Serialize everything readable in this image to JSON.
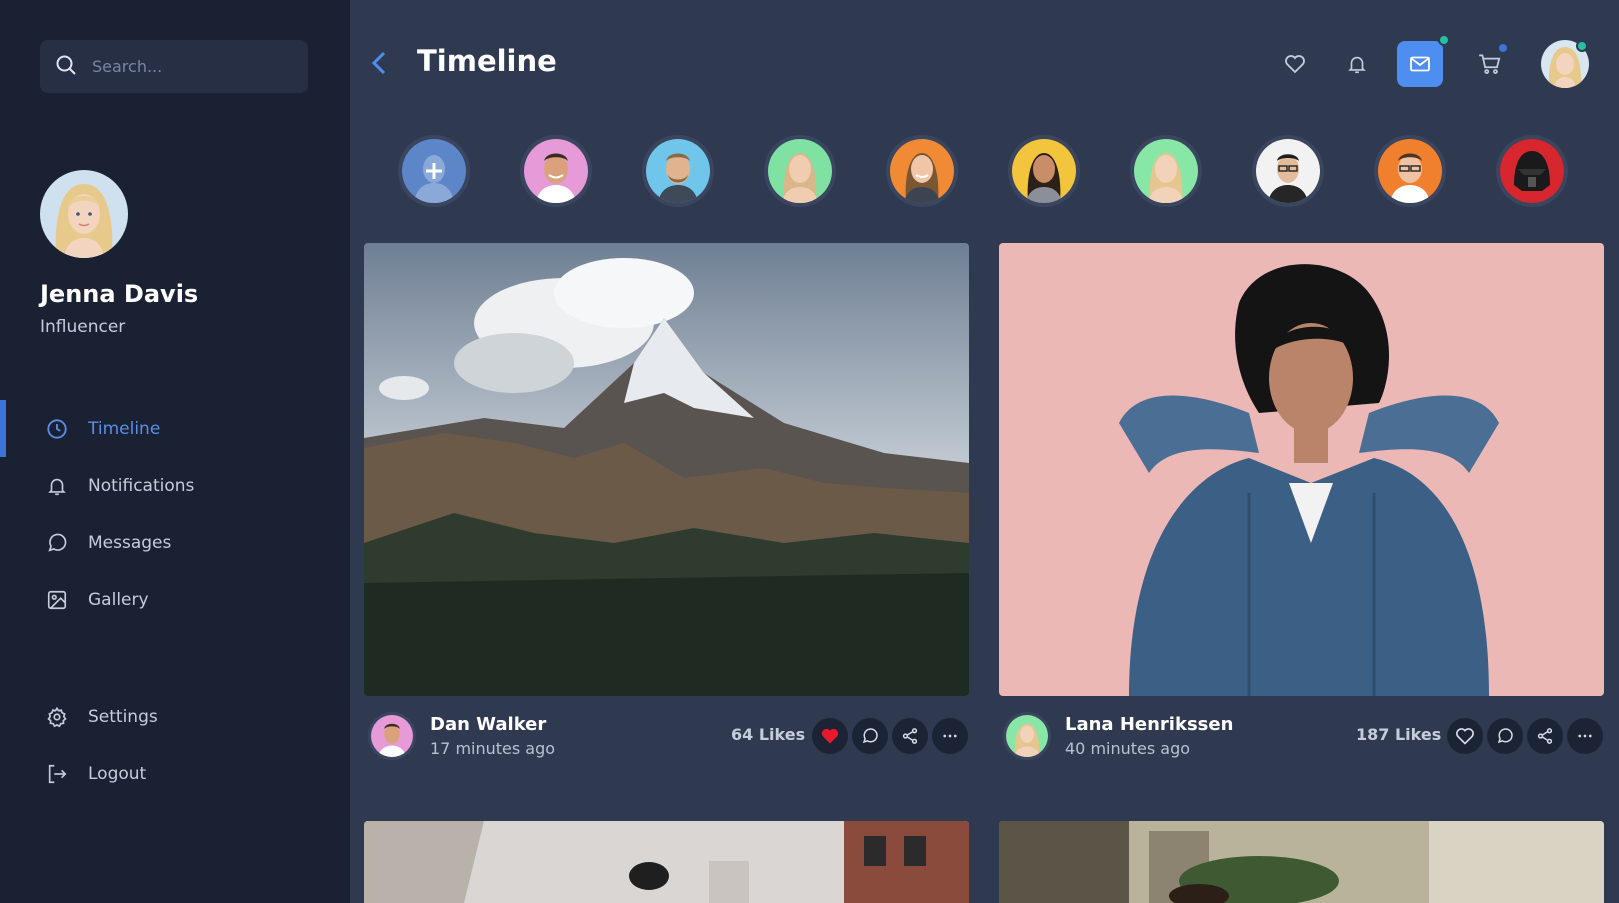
{
  "search": {
    "placeholder": "Search..."
  },
  "profile": {
    "name": "Jenna Davis",
    "role": "Influencer"
  },
  "nav": {
    "items": [
      {
        "label": "Timeline",
        "icon": "clock-icon",
        "active": true
      },
      {
        "label": "Notifications",
        "icon": "bell-icon"
      },
      {
        "label": "Messages",
        "icon": "message-icon"
      },
      {
        "label": "Gallery",
        "icon": "image-icon"
      }
    ],
    "bottom": [
      {
        "label": "Settings",
        "icon": "gear-icon"
      },
      {
        "label": "Logout",
        "icon": "logout-icon"
      }
    ]
  },
  "header": {
    "title": "Timeline",
    "icons": [
      "heart-icon",
      "bell-icon",
      "mail-icon",
      "cart-icon"
    ],
    "colors": {
      "accent": "#4d8ef0",
      "online": "#23c1a2",
      "cart_badge": "#3c74d8"
    }
  },
  "stories": [
    "add-story",
    "user-1",
    "user-2",
    "user-3",
    "user-4",
    "user-5",
    "user-6",
    "user-7",
    "user-8",
    "user-9"
  ],
  "posts": [
    {
      "author": "Dan Walker",
      "time": "17 minutes ago",
      "likes": "64 Likes",
      "liked": true,
      "image": "mountain-photo"
    },
    {
      "author": "Lana Henrikssen",
      "time": "40 minutes ago",
      "likes": "187 Likes",
      "liked": false,
      "image": "woman-denim-photo"
    }
  ],
  "colors": {
    "sidebar": "#1a2132",
    "background": "#2f3a51",
    "like_red": "#e8192c",
    "active_nav": "#5b8ee6"
  }
}
